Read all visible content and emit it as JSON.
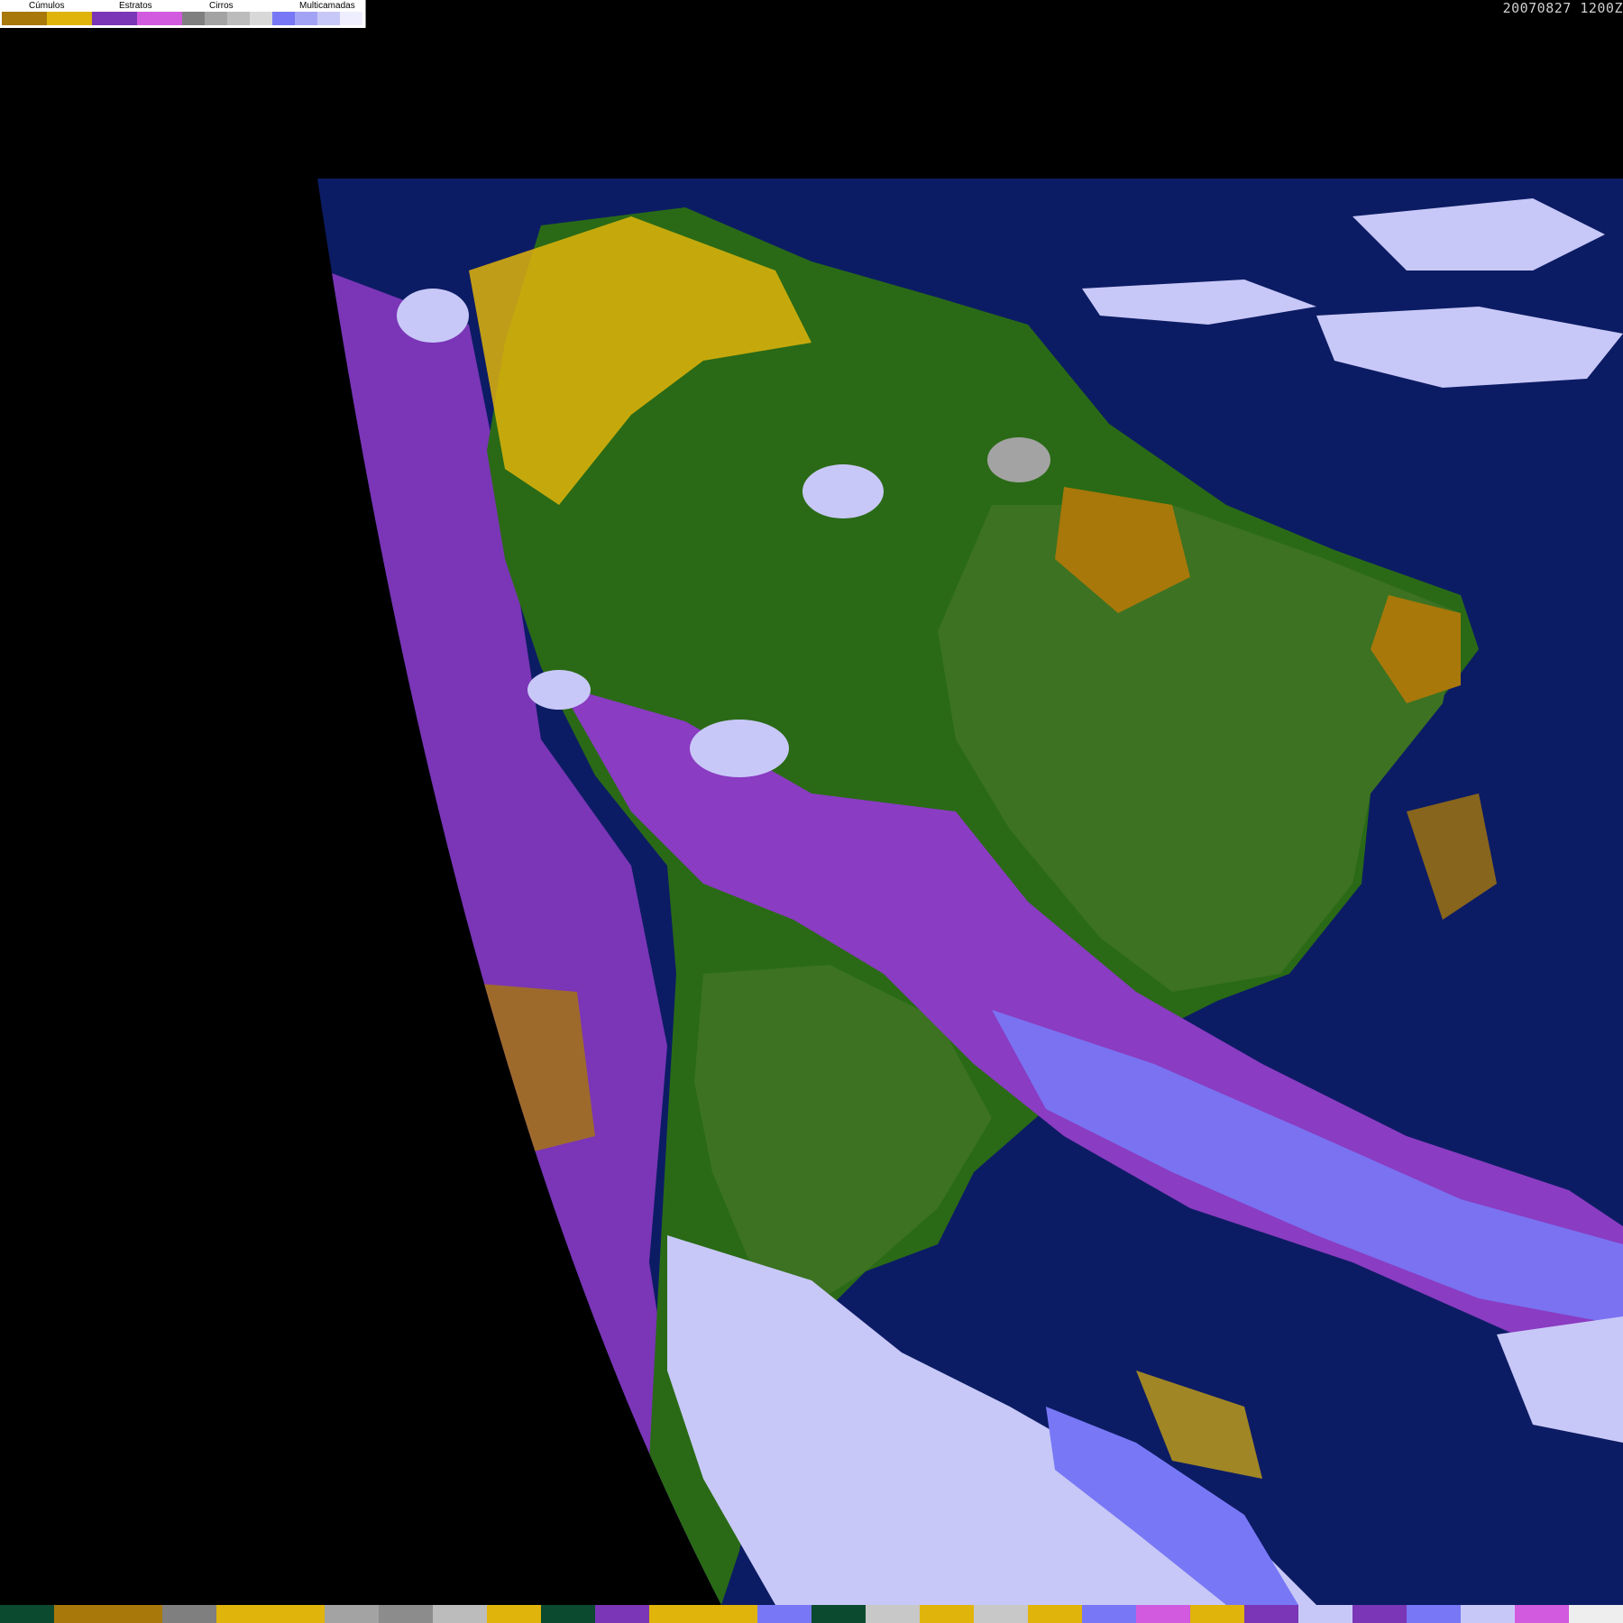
{
  "legend": {
    "groups": [
      {
        "label": "Cúmulos",
        "colors": [
          "#a8780a",
          "#e0b40a"
        ]
      },
      {
        "label": "Estratos",
        "colors": [
          "#7a36b6",
          "#d25ade"
        ]
      },
      {
        "label": "Cirros",
        "colors": [
          "#7f7f7f",
          "#a3a3a3",
          "#bcbcbc",
          "#d8d8d8"
        ]
      },
      {
        "label": "Multicamadas",
        "colors": [
          "#7878f6",
          "#a3a3f6",
          "#c8c8f8",
          "#eeeefe"
        ]
      }
    ]
  },
  "timestamp": "20070827 1200Z",
  "palette": {
    "ocean": "#0c1c64",
    "land_dark": "#1f6a10",
    "land_light": "#3c7222",
    "cumulus_dark": "#a8780a",
    "cumulus_light": "#e0b40a",
    "stratus": "#7a36b6",
    "stratus_light": "#d25ade",
    "cirrus": "#a3a3a3",
    "multilayer": "#7878f6",
    "multilayer_light": "#c8c8f8"
  },
  "bottom_strip": [
    "#0b4a2e",
    "#a8780a",
    "#a8780a",
    "#7f7f7f",
    "#e0b40a",
    "#e0b40a",
    "#a3a3a3",
    "#8c8c8c",
    "#bcbcbc",
    "#e0b40a",
    "#0b4a2e",
    "#7a36b6",
    "#e0b40a",
    "#e0b40a",
    "#7878f6",
    "#0b4a2e",
    "#c8c8c8",
    "#e0b40a",
    "#c8c8c8",
    "#e0b40a",
    "#7878f6",
    "#d25ade",
    "#e0b40a",
    "#7a36b6",
    "#c8c8f8",
    "#7a36b6",
    "#7878f6",
    "#c8c8f8",
    "#d25ade",
    "#eeeeee"
  ]
}
